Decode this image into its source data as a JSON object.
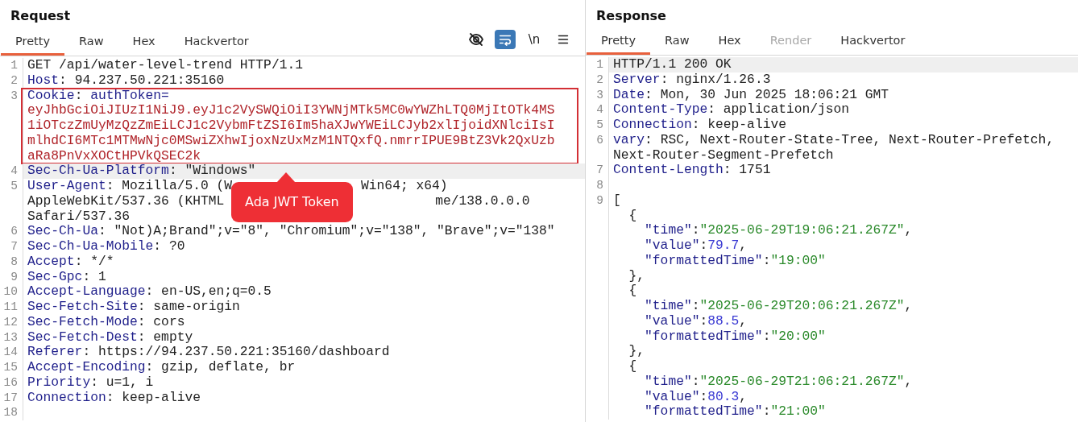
{
  "request": {
    "title": "Request",
    "tabs": [
      {
        "label": "Pretty",
        "selected": true,
        "disabled": false
      },
      {
        "label": "Raw",
        "selected": false,
        "disabled": false
      },
      {
        "label": "Hex",
        "selected": false,
        "disabled": false
      },
      {
        "label": "Hackvertor",
        "selected": false,
        "disabled": false
      }
    ],
    "toolbar": [
      {
        "kind": "hide",
        "on": false
      },
      {
        "kind": "wrap",
        "on": true
      },
      {
        "kind": "newline",
        "text": "\\n",
        "on": false
      },
      {
        "kind": "menu",
        "on": false
      }
    ],
    "lines": [
      {
        "number": "1",
        "highlighted": false,
        "boxed": false,
        "rows": [
          [
            {
              "kind": "value",
              "text": "GET /api/water-level-trend HTTP/1.1"
            }
          ]
        ]
      },
      {
        "number": "2",
        "highlighted": false,
        "boxed": false,
        "rows": [
          [
            {
              "kind": "name",
              "text": "Host"
            },
            {
              "kind": "punct",
              "text": ": "
            },
            {
              "kind": "value",
              "text": "94.237.50.221:35160"
            }
          ]
        ]
      },
      {
        "number": "3",
        "highlighted": false,
        "boxed": true,
        "rows": [
          [
            {
              "kind": "name",
              "text": "Cookie"
            },
            {
              "kind": "punct",
              "text": ": "
            },
            {
              "kind": "name",
              "text": "authToken="
            }
          ],
          [
            {
              "kind": "token",
              "text": "eyJhbGciOiJIUzI1NiJ9.eyJ1c2VySWQiOiI3YWNjMTk5MC0wYWZhLTQ0MjItOTk4MS"
            }
          ],
          [
            {
              "kind": "token",
              "text": "1iOTczZmUyMzQzZmEiLCJ1c2VybmFtZSI6Im5haXJwYWEiLCJyb2xlIjoidXNlciIsI"
            }
          ],
          [
            {
              "kind": "token",
              "text": "mlhdCI6MTc1MTMwNjc0MSwiZXhwIjoxNzUxMzM1NTQxfQ.nmrrIPUE9BtZ3Vk2QxUzb"
            }
          ],
          [
            {
              "kind": "token",
              "text": "aRa8PnVxXOCtHPVkQSEC2k"
            }
          ]
        ]
      },
      {
        "number": "4",
        "highlighted": true,
        "boxed": false,
        "rows": [
          [
            {
              "kind": "name",
              "text": "Sec-Ch-Ua-Platform"
            },
            {
              "kind": "punct",
              "text": ": "
            },
            {
              "kind": "value",
              "text": "\"Windows\""
            }
          ]
        ]
      },
      {
        "number": "5",
        "highlighted": false,
        "boxed": false,
        "rows": [
          [
            {
              "kind": "name",
              "text": "User-Agent"
            },
            {
              "kind": "punct",
              "text": ": "
            },
            {
              "kind": "value",
              "text": "Mozilla/5.0 (W"
            },
            {
              "kind": "gap"
            },
            {
              "kind": "value",
              "text": "Win64; x64)"
            }
          ],
          [
            {
              "kind": "value",
              "text": "AppleWebKit/537.36 (KHTML"
            },
            {
              "kind": "gap"
            },
            {
              "kind": "value",
              "text": "me/138.0.0.0"
            }
          ],
          [
            {
              "kind": "value",
              "text": "Safari/537.36"
            }
          ]
        ]
      },
      {
        "number": "6",
        "highlighted": false,
        "boxed": false,
        "rows": [
          [
            {
              "kind": "name",
              "text": "Sec-Ch-Ua"
            },
            {
              "kind": "punct",
              "text": ": "
            },
            {
              "kind": "value",
              "text": "\"Not)A;Brand\";v=\"8\", \"Chromium\";v=\"138\", \"Brave\";v=\"138\""
            }
          ]
        ]
      },
      {
        "number": "7",
        "highlighted": false,
        "boxed": false,
        "rows": [
          [
            {
              "kind": "name",
              "text": "Sec-Ch-Ua-Mobile"
            },
            {
              "kind": "punct",
              "text": ": "
            },
            {
              "kind": "value",
              "text": "?0"
            }
          ]
        ]
      },
      {
        "number": "8",
        "highlighted": false,
        "boxed": false,
        "rows": [
          [
            {
              "kind": "name",
              "text": "Accept"
            },
            {
              "kind": "punct",
              "text": ": "
            },
            {
              "kind": "value",
              "text": "*/*"
            }
          ]
        ]
      },
      {
        "number": "9",
        "highlighted": false,
        "boxed": false,
        "rows": [
          [
            {
              "kind": "name",
              "text": "Sec-Gpc"
            },
            {
              "kind": "punct",
              "text": ": "
            },
            {
              "kind": "value",
              "text": "1"
            }
          ]
        ]
      },
      {
        "number": "10",
        "highlighted": false,
        "boxed": false,
        "rows": [
          [
            {
              "kind": "name",
              "text": "Accept-Language"
            },
            {
              "kind": "punct",
              "text": ": "
            },
            {
              "kind": "value",
              "text": "en-US,en;q=0.5"
            }
          ]
        ]
      },
      {
        "number": "11",
        "highlighted": false,
        "boxed": false,
        "rows": [
          [
            {
              "kind": "name",
              "text": "Sec-Fetch-Site"
            },
            {
              "kind": "punct",
              "text": ": "
            },
            {
              "kind": "value",
              "text": "same-origin"
            }
          ]
        ]
      },
      {
        "number": "12",
        "highlighted": false,
        "boxed": false,
        "rows": [
          [
            {
              "kind": "name",
              "text": "Sec-Fetch-Mode"
            },
            {
              "kind": "punct",
              "text": ": "
            },
            {
              "kind": "value",
              "text": "cors"
            }
          ]
        ]
      },
      {
        "number": "13",
        "highlighted": false,
        "boxed": false,
        "rows": [
          [
            {
              "kind": "name",
              "text": "Sec-Fetch-Dest"
            },
            {
              "kind": "punct",
              "text": ": "
            },
            {
              "kind": "value",
              "text": "empty"
            }
          ]
        ]
      },
      {
        "number": "14",
        "highlighted": false,
        "boxed": false,
        "rows": [
          [
            {
              "kind": "name",
              "text": "Referer"
            },
            {
              "kind": "punct",
              "text": ": "
            },
            {
              "kind": "value",
              "text": "https://94.237.50.221:35160/dashboard"
            }
          ]
        ]
      },
      {
        "number": "15",
        "highlighted": false,
        "boxed": false,
        "rows": [
          [
            {
              "kind": "name",
              "text": "Accept-Encoding"
            },
            {
              "kind": "punct",
              "text": ": "
            },
            {
              "kind": "value",
              "text": "gzip, deflate, br"
            }
          ]
        ]
      },
      {
        "number": "16",
        "highlighted": false,
        "boxed": false,
        "rows": [
          [
            {
              "kind": "name",
              "text": "Priority"
            },
            {
              "kind": "punct",
              "text": ": "
            },
            {
              "kind": "value",
              "text": "u=1, i"
            }
          ]
        ]
      },
      {
        "number": "17",
        "highlighted": false,
        "boxed": false,
        "rows": [
          [
            {
              "kind": "name",
              "text": "Connection"
            },
            {
              "kind": "punct",
              "text": ": "
            },
            {
              "kind": "value",
              "text": "keep-alive"
            }
          ]
        ]
      },
      {
        "number": "18",
        "rows": [
          []
        ]
      }
    ],
    "callout": {
      "text": "Ada JWT Token"
    }
  },
  "response": {
    "title": "Response",
    "tabs": [
      {
        "label": "Pretty",
        "selected": true,
        "disabled": false
      },
      {
        "label": "Raw",
        "selected": false,
        "disabled": false
      },
      {
        "label": "Hex",
        "selected": false,
        "disabled": false
      },
      {
        "label": "Render",
        "selected": false,
        "disabled": true
      },
      {
        "label": "Hackvertor",
        "selected": false,
        "disabled": false
      }
    ],
    "lines": [
      {
        "number": "1",
        "highlighted": true,
        "boxed": false,
        "rows": [
          [
            {
              "kind": "value",
              "text": "HTTP/1.1 200 OK"
            }
          ]
        ]
      },
      {
        "number": "2",
        "highlighted": false,
        "boxed": false,
        "rows": [
          [
            {
              "kind": "name",
              "text": "Server"
            },
            {
              "kind": "punct",
              "text": ": "
            },
            {
              "kind": "value",
              "text": "nginx/1.26.3"
            }
          ]
        ]
      },
      {
        "number": "3",
        "highlighted": false,
        "boxed": false,
        "rows": [
          [
            {
              "kind": "name",
              "text": "Date"
            },
            {
              "kind": "punct",
              "text": ": "
            },
            {
              "kind": "value",
              "text": "Mon, 30 Jun 2025 18:06:21 GMT"
            }
          ]
        ]
      },
      {
        "number": "4",
        "highlighted": false,
        "boxed": false,
        "rows": [
          [
            {
              "kind": "name",
              "text": "Content-Type"
            },
            {
              "kind": "punct",
              "text": ": "
            },
            {
              "kind": "value",
              "text": "application/json"
            }
          ]
        ]
      },
      {
        "number": "5",
        "highlighted": false,
        "boxed": false,
        "rows": [
          [
            {
              "kind": "name",
              "text": "Connection"
            },
            {
              "kind": "punct",
              "text": ": "
            },
            {
              "kind": "value",
              "text": "keep-alive"
            }
          ]
        ]
      },
      {
        "number": "6",
        "highlighted": false,
        "boxed": false,
        "rows": [
          [
            {
              "kind": "name",
              "text": "vary"
            },
            {
              "kind": "punct",
              "text": ": "
            },
            {
              "kind": "value",
              "text": "RSC, Next-Router-State-Tree, Next-Router-Prefetch,"
            }
          ],
          [
            {
              "kind": "value",
              "text": "Next-Router-Segment-Prefetch"
            }
          ]
        ]
      },
      {
        "number": "7",
        "highlighted": false,
        "boxed": false,
        "rows": [
          [
            {
              "kind": "name",
              "text": "Content-Length"
            },
            {
              "kind": "punct",
              "text": ": "
            },
            {
              "kind": "value",
              "text": "1751"
            }
          ]
        ]
      },
      {
        "number": "8",
        "rows": [
          []
        ]
      },
      {
        "number": "9",
        "highlighted": false,
        "boxed": false,
        "rows": [
          [
            {
              "kind": "punct",
              "text": "["
            }
          ],
          [
            {
              "kind": "punct",
              "text": "  {"
            }
          ],
          [
            {
              "kind": "name",
              "text": "    \"time\""
            },
            {
              "kind": "punct",
              "text": ":"
            },
            {
              "kind": "string",
              "text": "\"2025-06-29T19:06:21.267Z\""
            },
            {
              "kind": "punct",
              "text": ","
            }
          ],
          [
            {
              "kind": "name",
              "text": "    \"value\""
            },
            {
              "kind": "punct",
              "text": ":"
            },
            {
              "kind": "number",
              "text": "79.7"
            },
            {
              "kind": "punct",
              "text": ","
            }
          ],
          [
            {
              "kind": "name",
              "text": "    \"formattedTime\""
            },
            {
              "kind": "punct",
              "text": ":"
            },
            {
              "kind": "string",
              "text": "\"19:00\""
            }
          ],
          [
            {
              "kind": "punct",
              "text": "  },"
            }
          ],
          [
            {
              "kind": "punct",
              "text": "  {"
            }
          ],
          [
            {
              "kind": "name",
              "text": "    \"time\""
            },
            {
              "kind": "punct",
              "text": ":"
            },
            {
              "kind": "string",
              "text": "\"2025-06-29T20:06:21.267Z\""
            },
            {
              "kind": "punct",
              "text": ","
            }
          ],
          [
            {
              "kind": "name",
              "text": "    \"value\""
            },
            {
              "kind": "punct",
              "text": ":"
            },
            {
              "kind": "number",
              "text": "88.5"
            },
            {
              "kind": "punct",
              "text": ","
            }
          ],
          [
            {
              "kind": "name",
              "text": "    \"formattedTime\""
            },
            {
              "kind": "punct",
              "text": ":"
            },
            {
              "kind": "string",
              "text": "\"20:00\""
            }
          ],
          [
            {
              "kind": "punct",
              "text": "  },"
            }
          ],
          [
            {
              "kind": "punct",
              "text": "  {"
            }
          ],
          [
            {
              "kind": "name",
              "text": "    \"time\""
            },
            {
              "kind": "punct",
              "text": ":"
            },
            {
              "kind": "string",
              "text": "\"2025-06-29T21:06:21.267Z\""
            },
            {
              "kind": "punct",
              "text": ","
            }
          ],
          [
            {
              "kind": "name",
              "text": "    \"value\""
            },
            {
              "kind": "punct",
              "text": ":"
            },
            {
              "kind": "number",
              "text": "80.3"
            },
            {
              "kind": "punct",
              "text": ","
            }
          ],
          [
            {
              "kind": "name",
              "text": "    \"formattedTime\""
            },
            {
              "kind": "punct",
              "text": ":"
            },
            {
              "kind": "string",
              "text": "\"21:00\""
            }
          ]
        ]
      }
    ]
  }
}
